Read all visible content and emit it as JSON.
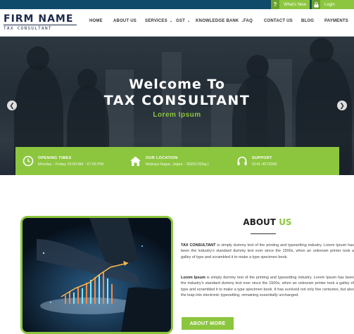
{
  "topbar": {
    "whats_new": "What's New",
    "login": "Login"
  },
  "logo": {
    "name": "FIRM NAME",
    "tagline": "TAX CONSULTANT"
  },
  "nav": {
    "items": [
      {
        "label": "HOME",
        "dropdown": false
      },
      {
        "label": "ABOUT US",
        "dropdown": false
      },
      {
        "label": "SERVICES",
        "dropdown": true
      },
      {
        "label": "GST",
        "dropdown": true
      },
      {
        "label": "KNOWLEDGE BANK",
        "dropdown": true
      },
      {
        "label": "FAQ",
        "dropdown": false
      },
      {
        "label": "CONTACT US",
        "dropdown": false
      },
      {
        "label": "BLOG",
        "dropdown": false
      },
      {
        "label": "PAYMENTS",
        "dropdown": false
      }
    ]
  },
  "hero": {
    "title_line1": "Welcome To",
    "title_line2": "TAX CONSULTANT",
    "subtitle": "Lorem Ipsum",
    "prev_icon": "chevron-left-icon",
    "next_icon": "chevron-right-icon"
  },
  "info": {
    "opening": {
      "label": "OPENING TIMES",
      "value": "Monday - Friday 10:00 AM - 07:00 PM",
      "icon": "clock-icon"
    },
    "location": {
      "label": "OUR LOCATION",
      "value": "Malviya Nagar, Jaipur - 302017(Raj.)",
      "icon": "home-icon"
    },
    "support": {
      "label": "SUPPORT",
      "value": "0141-4072000",
      "icon": "headset-icon"
    }
  },
  "about": {
    "title_main": "ABOUT",
    "title_accent": "US",
    "para1_lead": "TAX CONSULTANT",
    "para1_body": " is simply dummy text of the printing and typesetting industry. Lorem Ipsum has been the industry's standard dummy text ever since the 1500s, when an unknown printer took a galley of type and scrambled it to make a type specimen book.",
    "para2_lead": "Lorem Ipsum",
    "para2_body": " is simply dummy text of the printing and typesetting industry. Lorem Ipsum has been the industry's standard dummy text ever since the 1500s, when an unknown printer took a galley of type and scrambled it to make a type specimen book. It has survived not only five centuries, but also the leap into electronic typesetting, remaining essentially unchanged.",
    "button": "ABOUT MORE"
  },
  "colors": {
    "accent_green": "#8cc63f",
    "topbar_blue": "#0f4a6a",
    "logo_navy": "#1e2a4a"
  }
}
